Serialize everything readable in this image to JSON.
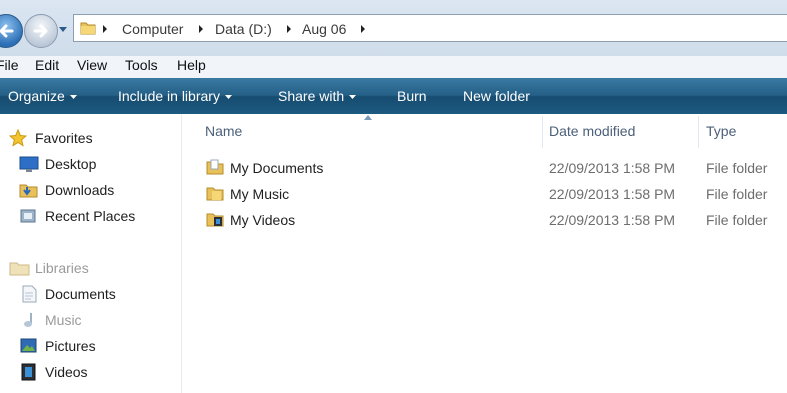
{
  "address": {
    "breadcrumb": [
      "Computer",
      "Data (D:)",
      "Aug 06"
    ]
  },
  "menu": [
    "File",
    "Edit",
    "View",
    "Tools",
    "Help"
  ],
  "commands": {
    "organize": "Organize",
    "include_in_library": "Include in library",
    "share_with": "Share with",
    "burn": "Burn",
    "new_folder": "New folder"
  },
  "nav": {
    "favorites": {
      "label": "Favorites",
      "icon": "star-icon"
    },
    "favorite_items": [
      {
        "label": "Desktop",
        "icon": "desktop-icon"
      },
      {
        "label": "Downloads",
        "icon": "downloads-folder-icon"
      },
      {
        "label": "Recent Places",
        "icon": "recent-places-icon"
      }
    ],
    "libraries": {
      "label": "Libraries",
      "icon": "libraries-icon"
    },
    "library_items": [
      {
        "label": "Documents",
        "icon": "documents-library-icon"
      },
      {
        "label": "Music",
        "icon": "music-library-icon"
      },
      {
        "label": "Pictures",
        "icon": "pictures-library-icon"
      },
      {
        "label": "Videos",
        "icon": "videos-library-icon"
      }
    ]
  },
  "columns": {
    "name": "Name",
    "date_modified": "Date modified",
    "type": "Type"
  },
  "files": [
    {
      "name": "My Documents",
      "date": "22/09/2013 1:58 PM",
      "type": "File folder",
      "icon": "documents-folder-icon"
    },
    {
      "name": "My Music",
      "date": "22/09/2013 1:58 PM",
      "type": "File folder",
      "icon": "music-folder-icon"
    },
    {
      "name": "My Videos",
      "date": "22/09/2013 1:58 PM",
      "type": "File folder",
      "icon": "videos-folder-icon"
    }
  ],
  "colors": {
    "command_bar": "#245f86",
    "column_header_text": "#4c607a",
    "secondary_text": "#6d6d6d"
  }
}
